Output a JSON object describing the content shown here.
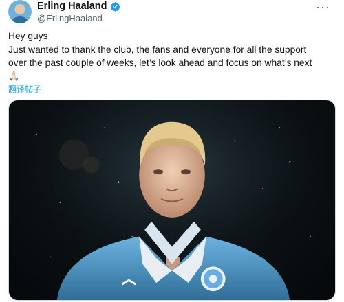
{
  "user": {
    "display_name": "Erling Haaland",
    "handle": "@ErlingHaaland"
  },
  "tweet": {
    "line1": "Hey guys",
    "line2": "Just wanted to thank the club, the fans and everyone for all the support",
    "line3": "over the past couple of weeks, let’s look ahead and focus on what’s next",
    "emoji": "🙏🏻",
    "translate_label": "翻译帖子"
  },
  "media": {
    "image_label": "photo"
  },
  "colors": {
    "verified": "#1d9bf0",
    "link": "#1d9bf0",
    "jersey": "#5ea8d6"
  }
}
